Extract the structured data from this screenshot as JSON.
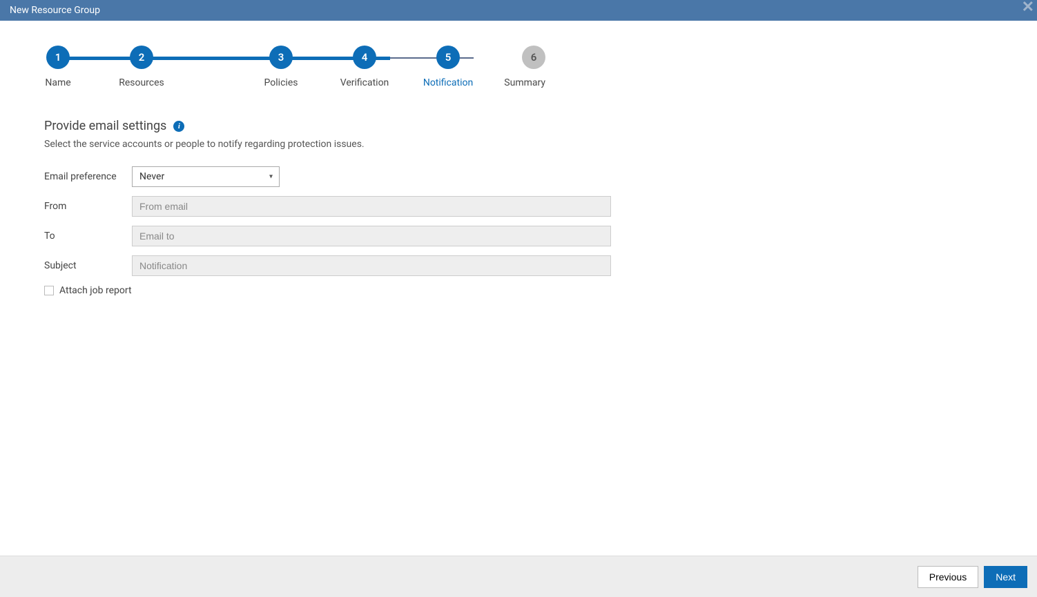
{
  "header": {
    "title": "New Resource Group"
  },
  "stepper": {
    "steps": [
      {
        "num": "1",
        "label": "Name"
      },
      {
        "num": "2",
        "label": "Resources"
      },
      {
        "num": "3",
        "label": "Policies"
      },
      {
        "num": "4",
        "label": "Verification"
      },
      {
        "num": "5",
        "label": "Notification"
      },
      {
        "num": "6",
        "label": "Summary"
      }
    ]
  },
  "section": {
    "title": "Provide email settings",
    "subtitle": "Select the service accounts or people to notify regarding protection issues."
  },
  "form": {
    "emailPreference": {
      "label": "Email preference",
      "value": "Never"
    },
    "from": {
      "label": "From",
      "placeholder": "From email"
    },
    "to": {
      "label": "To",
      "placeholder": "Email to"
    },
    "subject": {
      "label": "Subject",
      "placeholder": "Notification"
    },
    "attachJobReport": {
      "label": "Attach job report"
    }
  },
  "footer": {
    "previous": "Previous",
    "next": "Next"
  }
}
